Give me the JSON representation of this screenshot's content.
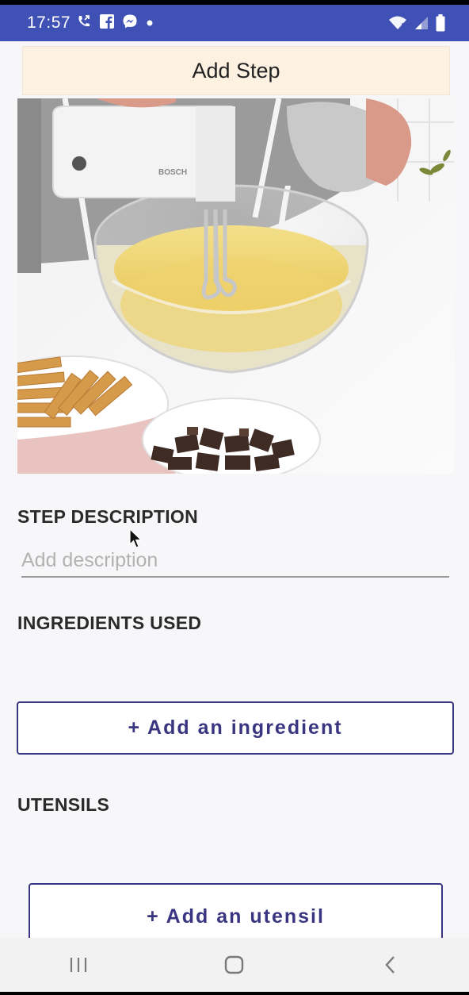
{
  "status_bar": {
    "time": "17:57",
    "left_icons": [
      "call-forward-icon",
      "facebook-icon",
      "messenger-icon",
      "dot-icon"
    ],
    "right_icons": [
      "wifi-icon",
      "signal-icon",
      "battery-icon"
    ],
    "color": "#3f51b5"
  },
  "header": {
    "add_step_label": "Add Step",
    "button_color": "#fdf2e2"
  },
  "step_image": {
    "description_icon": "photo-mixing-bowl",
    "brand_text": "BOSCH"
  },
  "step_description": {
    "label": "STEP DESCRIPTION",
    "placeholder": "Add description",
    "value": ""
  },
  "ingredients": {
    "label": "INGREDIENTS USED",
    "add_button_label": "+ Add an ingredient"
  },
  "utensils": {
    "label": "UTENSILS",
    "add_button_label": "+ Add an utensil"
  },
  "nav_bar": {
    "icons": [
      "recents-icon",
      "home-icon",
      "back-icon"
    ]
  },
  "accent_color": "#3a3580"
}
